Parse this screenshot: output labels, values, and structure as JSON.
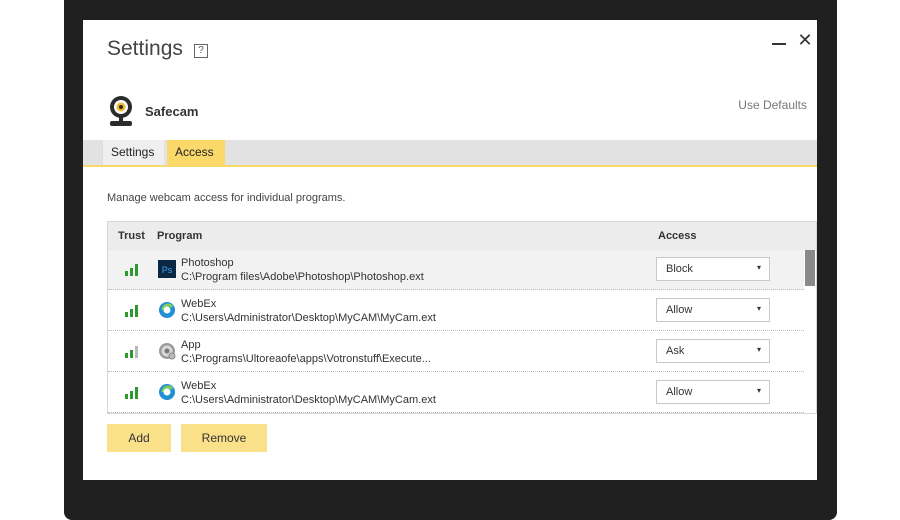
{
  "window": {
    "title": "Settings",
    "help_label": "?",
    "close_label": "✕"
  },
  "product": {
    "name": "Safecam",
    "use_defaults_label": "Use Defaults"
  },
  "tabs": [
    {
      "label": "Settings",
      "active": false
    },
    {
      "label": "Access",
      "active": true
    }
  ],
  "description": "Manage webcam access for individual programs.",
  "table": {
    "headers": {
      "trust": "Trust",
      "program": "Program",
      "access": "Access"
    },
    "rows": [
      {
        "trust_level": 3,
        "icon": "photoshop-icon",
        "icon_text": "Ps",
        "name": "Photoshop",
        "path": "C:\\Program files\\Adobe\\Photoshop\\Photoshop.ext",
        "access": "Block",
        "selected": true
      },
      {
        "trust_level": 3,
        "icon": "webex-icon",
        "name": "WebEx",
        "path": "C:\\Users\\Administrator\\Desktop\\MyCAM\\MyCam.ext",
        "access": "Allow",
        "selected": false
      },
      {
        "trust_level": 2,
        "icon": "generic-app-icon",
        "name": "App",
        "path": "C:\\Programs\\Ultoreaofe\\apps\\Votronstuff\\Execute...",
        "access": "Ask",
        "selected": false
      },
      {
        "trust_level": 3,
        "icon": "webex-icon",
        "name": "WebEx",
        "path": "C:\\Users\\Administrator\\Desktop\\MyCAM\\MyCam.ext",
        "access": "Allow",
        "selected": false
      }
    ]
  },
  "buttons": {
    "add_label": "Add",
    "remove_label": "Remove"
  },
  "colors": {
    "accent": "#fad86a",
    "trust_green": "#2e9a2e",
    "trust_gray": "#b8b8b8"
  }
}
